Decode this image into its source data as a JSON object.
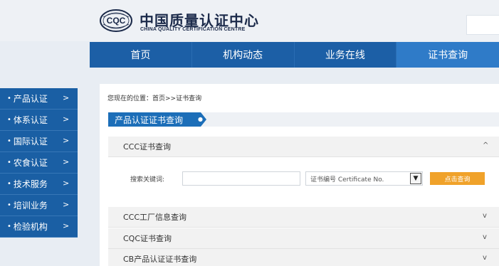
{
  "header": {
    "logo_badge_text": "CQC",
    "logo_cn": "中国质量认证中心",
    "logo_en": "CHINA QUALITY CERTIFICATION CENTRE"
  },
  "nav": {
    "items": [
      {
        "label": "首页",
        "active": false
      },
      {
        "label": "机构动态",
        "active": false
      },
      {
        "label": "业务在线",
        "active": false
      },
      {
        "label": "证书查询",
        "active": true
      }
    ]
  },
  "sidebar": {
    "items": [
      {
        "bullet": "•",
        "label": "产品认证",
        "chevron": ">"
      },
      {
        "bullet": "•",
        "label": "体系认证",
        "chevron": ">"
      },
      {
        "bullet": "•",
        "label": "国际认证",
        "chevron": ">"
      },
      {
        "bullet": "•",
        "label": "农食认证",
        "chevron": ">"
      },
      {
        "bullet": "•",
        "label": "技术服务",
        "chevron": ">"
      },
      {
        "bullet": "•",
        "label": "培训业务",
        "chevron": ">"
      },
      {
        "bullet": "•",
        "label": "检验机构",
        "chevron": ">"
      }
    ]
  },
  "main": {
    "breadcrumb": "您现在的位置：首页>>证书查询",
    "section_title": "产品认证证书查询",
    "accordion": [
      {
        "label": "CCC证书查询",
        "chevron": "^",
        "expanded": true
      },
      {
        "label": "CCC工厂信息查询",
        "chevron": "v",
        "expanded": false
      },
      {
        "label": "CQC证书查询",
        "chevron": "v",
        "expanded": false
      },
      {
        "label": "CB产品认证证书查询",
        "chevron": "v",
        "expanded": false
      }
    ],
    "search": {
      "label": "搜索关键词:",
      "input_value": "",
      "select_value": "证书编号 Certificate No.",
      "button_label": "点击查询"
    }
  },
  "colors": {
    "nav_blue": "#1c5fa6",
    "nav_active": "#2f7bc8",
    "sidebar_blue": "#1a5fa4",
    "button_orange": "#f0a22a"
  }
}
